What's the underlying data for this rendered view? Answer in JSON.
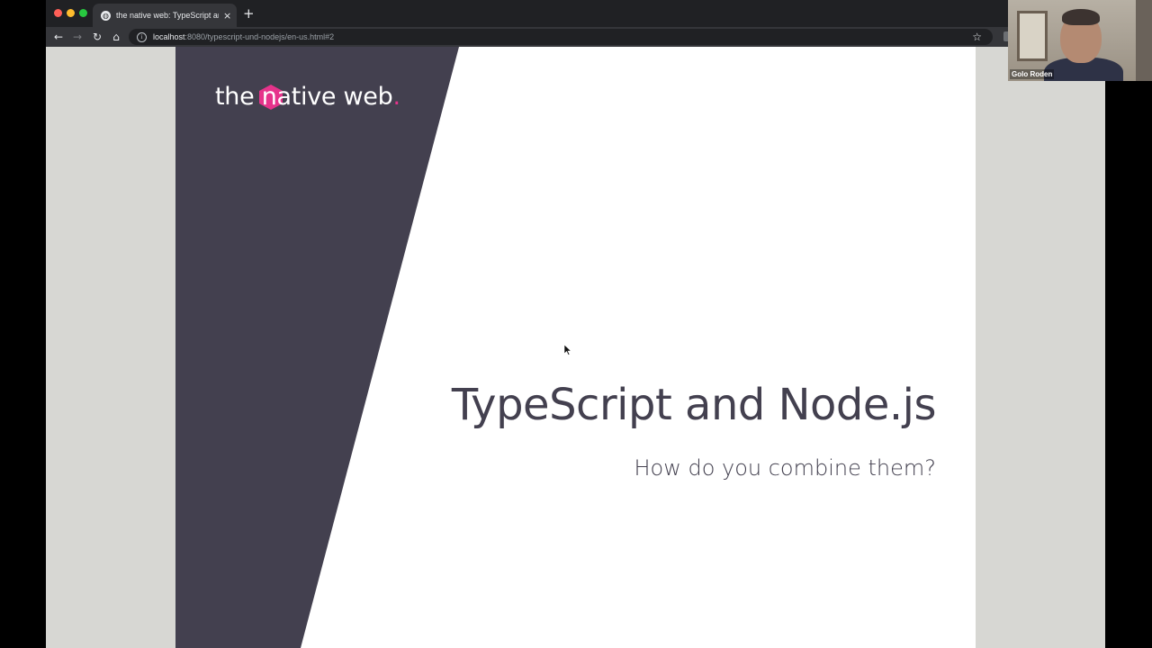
{
  "browser": {
    "tab_title": "the native web: TypeScript and Node.js",
    "tab_favicon": "globe-icon",
    "tab_close": "×",
    "new_tab": "+",
    "nav": {
      "back": "←",
      "forward": "→",
      "reload": "↻",
      "home": "⌂"
    },
    "url_host": "localhost",
    "url_rest": ":8080/typescript-und-nodejs/en-us.html#2",
    "info_icon": "i",
    "bookmark_icon": "☆"
  },
  "slide": {
    "logo_text": "the native web",
    "logo_dot": ".",
    "title": "TypeScript and Node.js",
    "subtitle": "How do you combine them?",
    "colors": {
      "panel": "#43404f",
      "accent": "#e6338b",
      "background": "#ffffff"
    }
  },
  "webcam": {
    "name": "Golo Roden"
  }
}
